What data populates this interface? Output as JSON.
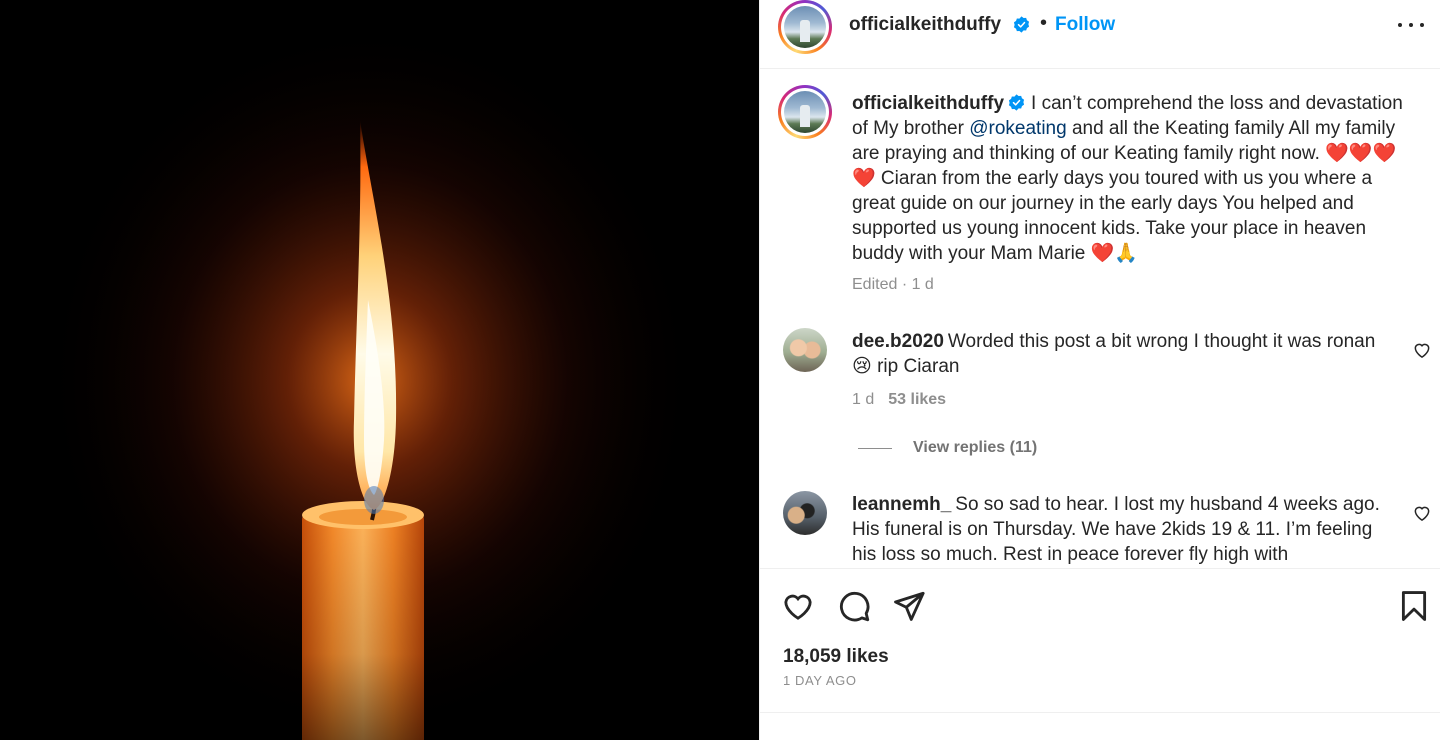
{
  "post": {
    "username": "officialkeithduffy",
    "follow_label": "Follow",
    "header_separator": "•",
    "caption_parts": {
      "p1": "I can’t comprehend the loss and devastation of My brother ",
      "mention": "@rokeating",
      "p2": " and all the Keating family All my family are praying and thinking of our Keating family right now. ❤️❤️❤️❤️ Ciaran from the early days you toured with us you where a great guide on our journey in the early days You helped and supported us young innocent kids. Take your place in heaven buddy with your Mam Marie ❤️🙏"
    },
    "caption_meta": "Edited · 1 d",
    "likes": "18,059 likes",
    "date": "1 day ago"
  },
  "comments": [
    {
      "username": "dee.b2020",
      "text": "Worded this post a bit wrong I thought it was ronan 😢 rip Ciaran",
      "age": "1 d",
      "likes": "53 likes",
      "view_replies": "View replies (11)"
    },
    {
      "username": "leannemh_",
      "text": "So so sad to hear. I lost my husband 4 weeks ago. His funeral is on Thursday. We have 2kids 19 & 11. I’m feeling his loss so much. Rest in peace forever fly high with"
    }
  ],
  "icons": {
    "verified": "verified-badge-icon",
    "more": "more-options-icon",
    "like": "heart-icon",
    "comment": "comment-icon",
    "share": "share-icon",
    "save": "bookmark-icon"
  },
  "colors": {
    "accent": "#0095f6",
    "mention": "#00376b",
    "muted": "#8e8e8e",
    "text": "#262626"
  }
}
